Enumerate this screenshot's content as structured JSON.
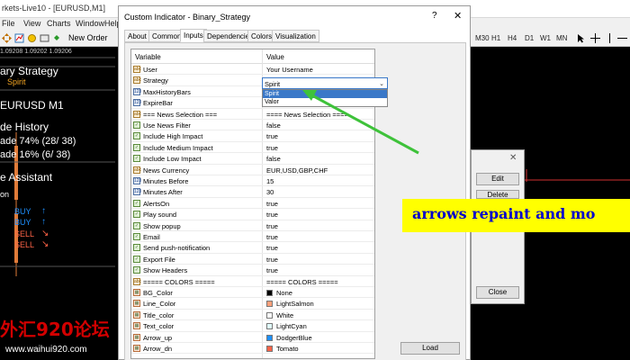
{
  "mt4": {
    "title": "rkets-Live10 - [EURUSD,M1]",
    "menu": [
      "File",
      "View",
      "Charts",
      "Window"
    ],
    "menu_help": "Help",
    "toolbar": {
      "new_order": "New Order"
    },
    "timeframes": [
      "M30",
      "H1",
      "H4",
      "D1",
      "W1",
      "MN"
    ],
    "price_row": "1.09208 1.09202 1.09206",
    "panel": {
      "strategy_title": "ary Strategy",
      "strategy_name": "Spirit",
      "symbol": "EURUSD M1",
      "history_title": "de History",
      "history_line1": "ade 74% (28/ 38)",
      "history_line2": "ade 16% (6/ 38)",
      "assistant_title": "e Assistant",
      "assistant_sub": "on",
      "signals": [
        {
          "label": "BUY",
          "arrow": "↑",
          "color": "#1e90ff"
        },
        {
          "label": "BUY",
          "arrow": "↑",
          "color": "#1e90ff"
        },
        {
          "label": "SELL",
          "arrow": "↘",
          "color": "#ff6347"
        },
        {
          "label": "SELL",
          "arrow": "↘",
          "color": "#ff6347"
        }
      ]
    }
  },
  "dialog": {
    "title": "Custom Indicator - Binary_Strategy",
    "help": "?",
    "close": "✕",
    "tabs": [
      "About",
      "Common",
      "Inputs",
      "Dependencies",
      "Colors",
      "Visualization"
    ],
    "active_tab": "Inputs",
    "headers": {
      "variable": "Variable",
      "value": "Value"
    },
    "rows": [
      {
        "icon": "abc",
        "name": "User",
        "value": "Your Username"
      },
      {
        "icon": "abc",
        "name": "Strategy",
        "value": ""
      },
      {
        "icon": "num",
        "name": "MaxHistoryBars",
        "value": ""
      },
      {
        "icon": "num",
        "name": "ExpireBar",
        "value": ""
      },
      {
        "icon": "abc",
        "name": "=== News Selection ===",
        "value": "==== News Selection ===="
      },
      {
        "icon": "bool",
        "name": "Use News Filter",
        "value": "false"
      },
      {
        "icon": "bool",
        "name": "Include High Impact",
        "value": "true"
      },
      {
        "icon": "bool",
        "name": "Include Medium Impact",
        "value": "true"
      },
      {
        "icon": "bool",
        "name": "Include Low Impact",
        "value": "false"
      },
      {
        "icon": "abc",
        "name": "News Currency",
        "value": "EUR,USD,GBP,CHF"
      },
      {
        "icon": "num",
        "name": "Minutes Before",
        "value": "15"
      },
      {
        "icon": "num",
        "name": "Minutes After",
        "value": "30"
      },
      {
        "icon": "bool",
        "name": "AlertsOn",
        "value": "true"
      },
      {
        "icon": "bool",
        "name": "Play sound",
        "value": "true"
      },
      {
        "icon": "bool",
        "name": "Show popup",
        "value": "true"
      },
      {
        "icon": "bool",
        "name": "Email",
        "value": "true"
      },
      {
        "icon": "bool",
        "name": "Send push-notification",
        "value": "true"
      },
      {
        "icon": "bool",
        "name": "Export File",
        "value": "true"
      },
      {
        "icon": "bool",
        "name": "Show Headers",
        "value": "true"
      },
      {
        "icon": "abc",
        "name": "===== COLORS =====",
        "value": "===== COLORS ====="
      },
      {
        "icon": "col",
        "name": "BG_Color",
        "value": "None",
        "swatch": "#000000"
      },
      {
        "icon": "col",
        "name": "Line_Color",
        "value": "LightSalmon",
        "swatch": "#ffa07a"
      },
      {
        "icon": "col",
        "name": "Title_color",
        "value": "White",
        "swatch": "#ffffff"
      },
      {
        "icon": "col",
        "name": "Text_color",
        "value": "LightCyan",
        "swatch": "#e0ffff"
      },
      {
        "icon": "col",
        "name": "Arrow_up",
        "value": "DodgerBlue",
        "swatch": "#1e90ff"
      },
      {
        "icon": "col",
        "name": "Arrow_dn",
        "value": "Tomato",
        "swatch": "#ff6347"
      }
    ],
    "strategy_select": {
      "value": "Spirit",
      "options": [
        "Spirit",
        "Valor"
      ],
      "highlighted": "Spirit"
    },
    "load_button": "Load"
  },
  "side_dialog": {
    "close": "✕",
    "edit": "Edit",
    "delete": "Delete",
    "close_button": "Close"
  },
  "annotation": {
    "text": "arrows repaint and mo",
    "arrow_color": "#3ec23a",
    "banner_color": "#ffff00"
  },
  "watermark": {
    "cn": "外汇920论坛",
    "url": "www.waihui920.com"
  }
}
